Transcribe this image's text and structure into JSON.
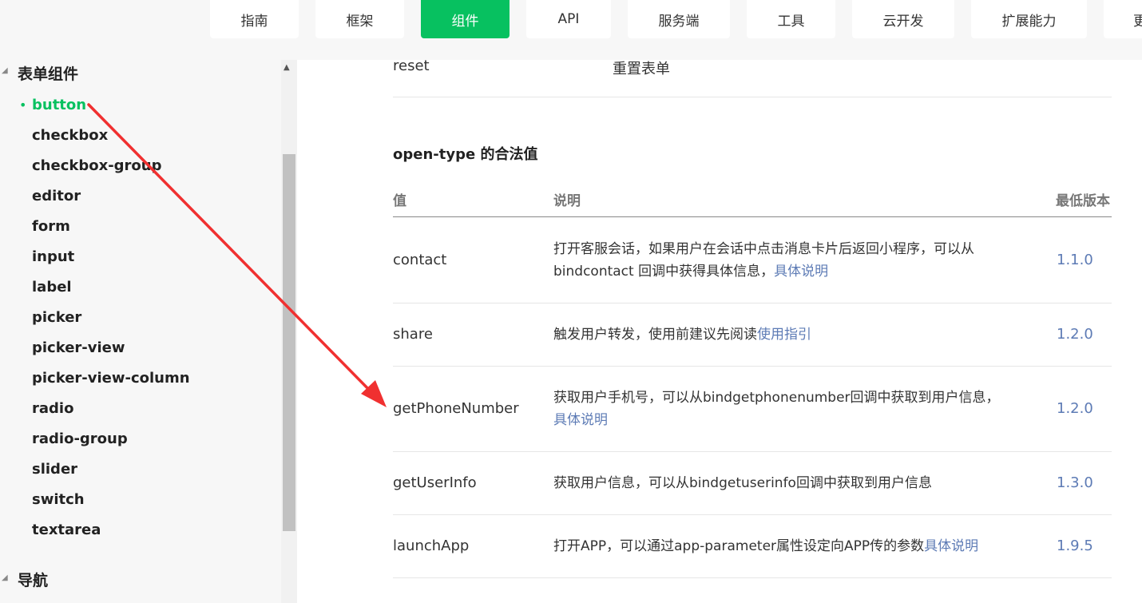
{
  "nav": {
    "tabs": [
      {
        "label": "指南"
      },
      {
        "label": "框架"
      },
      {
        "label": "组件"
      },
      {
        "label": "API"
      },
      {
        "label": "服务端"
      },
      {
        "label": "工具"
      },
      {
        "label": "云开发"
      },
      {
        "label": "扩展能力"
      },
      {
        "label": "更"
      }
    ],
    "active_index": 2
  },
  "sidebar": {
    "group_form": "表单组件",
    "items": [
      {
        "label": "button"
      },
      {
        "label": "checkbox"
      },
      {
        "label": "checkbox-group"
      },
      {
        "label": "editor"
      },
      {
        "label": "form"
      },
      {
        "label": "input"
      },
      {
        "label": "label"
      },
      {
        "label": "picker"
      },
      {
        "label": "picker-view"
      },
      {
        "label": "picker-view-column"
      },
      {
        "label": "radio"
      },
      {
        "label": "radio-group"
      },
      {
        "label": "slider"
      },
      {
        "label": "switch"
      },
      {
        "label": "textarea"
      }
    ],
    "active_item": "button",
    "group_nav": "导航"
  },
  "main": {
    "prev_row": {
      "value": "reset",
      "desc": "重置表单"
    },
    "section_title": "open-type 的合法值",
    "table": {
      "headers": {
        "value": "值",
        "desc": "说明",
        "version": "最低版本"
      },
      "rows": [
        {
          "value": "contact",
          "desc_line1": "打开客服会话，如果用户在会话中点击消息卡片后返回小程序，可以从",
          "desc_line2": "bindcontact 回调中获得具体信息，",
          "link": "具体说明",
          "version": "1.1.0"
        },
        {
          "value": "share",
          "desc_line1": "触发用户转发，使用前建议先阅读",
          "link": "使用指引",
          "version": "1.2.0"
        },
        {
          "value": "getPhoneNumber",
          "desc_line1": "获取用户手机号，可以从bindgetphonenumber回调中获取到用户信息，",
          "link": "具体说明",
          "version": "1.2.0"
        },
        {
          "value": "getUserInfo",
          "desc_line1": "获取用户信息，可以从bindgetuserinfo回调中获取到用户信息",
          "version": "1.3.0"
        },
        {
          "value": "launchApp",
          "desc_line1": "打开APP，可以通过app-parameter属性设定向APP传的参数",
          "link": "具体说明",
          "version": "1.9.5"
        }
      ]
    }
  },
  "colors": {
    "accent": "#07c160",
    "link": "#5d7bb5",
    "annotation_arrow": "#f03030"
  }
}
